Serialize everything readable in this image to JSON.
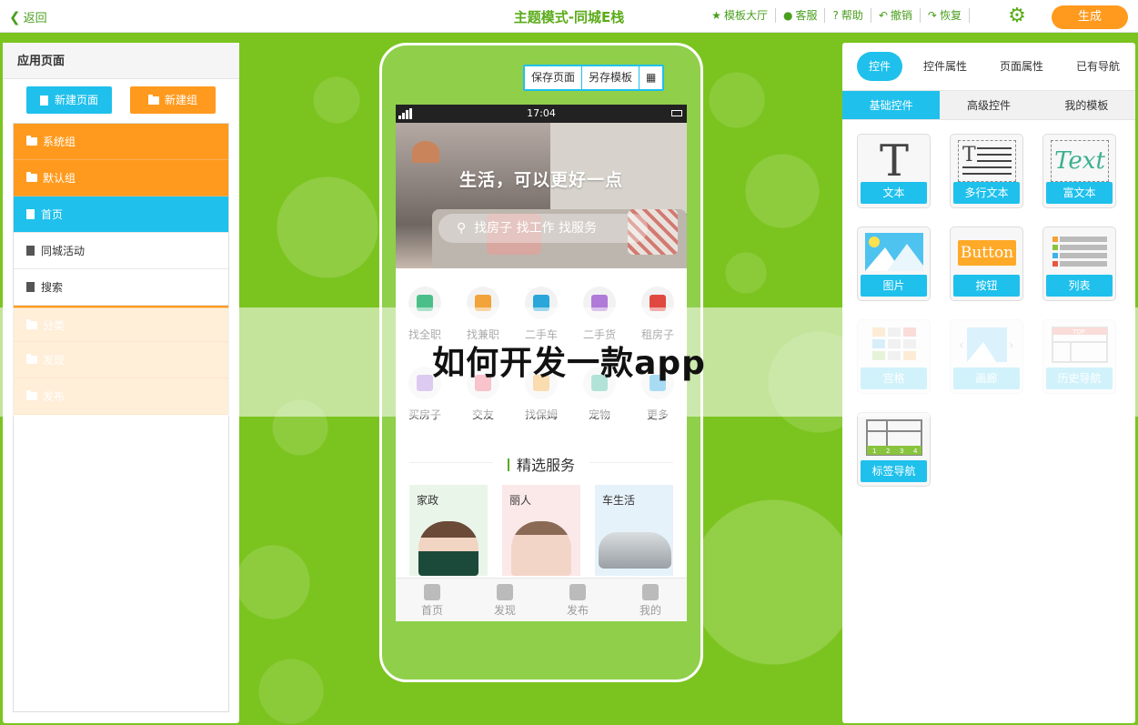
{
  "topbar": {
    "back_label": "返回",
    "title": "主题模式-同城E栈",
    "actions": [
      {
        "icon": "star-icon",
        "label": "模板大厅"
      },
      {
        "icon": "user-icon",
        "label": "客服"
      },
      {
        "icon": "help-icon",
        "label": "帮助"
      },
      {
        "icon": "undo-icon",
        "label": "撤销"
      },
      {
        "icon": "redo-icon",
        "label": "恢复"
      }
    ],
    "generate_label": "生成"
  },
  "left_panel": {
    "title": "应用页面",
    "new_page_label": "新建页面",
    "new_group_label": "新建组",
    "tree": [
      {
        "label": "系统组",
        "type": "group"
      },
      {
        "label": "默认组",
        "type": "group-open"
      },
      {
        "label": "首页",
        "type": "page-active"
      },
      {
        "label": "同城活动",
        "type": "page"
      },
      {
        "label": "搜索",
        "type": "page"
      },
      {
        "label": "分类",
        "type": "group-light"
      },
      {
        "label": "发现",
        "type": "group-light"
      },
      {
        "label": "发布",
        "type": "group-light"
      }
    ]
  },
  "phone": {
    "toolbar": [
      "保存页面",
      "另存模板",
      "▦"
    ],
    "status_time": "17:04",
    "banner_title": "生活，可以更好一点",
    "search_placeholder": "找房子 找工作 找服务",
    "categories": [
      {
        "label": "找全职",
        "color": "#4bbf8a"
      },
      {
        "label": "找兼职",
        "color": "#f2a33a"
      },
      {
        "label": "二手车",
        "color": "#2aa7d8"
      },
      {
        "label": "二手货",
        "color": "#b07ad8"
      },
      {
        "label": "租房子",
        "color": "#e0493f"
      },
      {
        "label": "买房子",
        "color": "#b48be0"
      },
      {
        "label": "交友",
        "color": "#f07a8a"
      },
      {
        "label": "找保姆",
        "color": "#f5b050"
      },
      {
        "label": "宠物",
        "color": "#58c1a8"
      },
      {
        "label": "更多",
        "color": "#3fb2e8"
      }
    ],
    "section_title": "精选服务",
    "cards": [
      {
        "label": "家政",
        "bg": "#eaf5ea"
      },
      {
        "label": "丽人",
        "bg": "#fbe9ea"
      },
      {
        "label": "车生活",
        "bg": "#e6f2fa"
      }
    ],
    "tabbar": [
      "首页",
      "发现",
      "发布",
      "我的"
    ]
  },
  "right_panel": {
    "tabs": [
      "控件",
      "控件属性",
      "页面属性",
      "已有导航"
    ],
    "subtabs": [
      "基础控件",
      "高级控件",
      "我的模板"
    ],
    "widgets": [
      {
        "label": "文本",
        "dim": false
      },
      {
        "label": "多行文本",
        "dim": false
      },
      {
        "label": "富文本",
        "dim": false
      },
      {
        "label": "图片",
        "dim": false
      },
      {
        "label": "按钮",
        "dim": false
      },
      {
        "label": "列表",
        "dim": false
      },
      {
        "label": "宫格",
        "dim": true
      },
      {
        "label": "画廊",
        "dim": true
      },
      {
        "label": "历史导航",
        "dim": true
      },
      {
        "label": "标签导航",
        "dim": false
      }
    ],
    "widget_art": {
      "text": "T",
      "richtext": "Text",
      "button": "Button",
      "top": "TOP",
      "tabs": [
        "1",
        "2",
        "3",
        "4"
      ]
    }
  },
  "overlay_headline": "如何开发一款app"
}
